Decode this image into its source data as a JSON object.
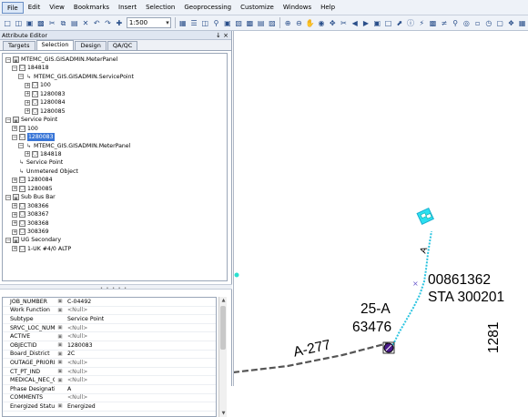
{
  "menu": [
    "File",
    "Edit",
    "View",
    "Bookmarks",
    "Insert",
    "Selection",
    "Geoprocessing",
    "Customize",
    "Windows",
    "Help"
  ],
  "toolbar": {
    "scale": "1:500"
  },
  "editor": {
    "title": "Attribute Editor",
    "title_buttons": "↓ ×",
    "tabs": [
      "Targets",
      "Selection",
      "Design",
      "QA/QC"
    ],
    "tree": [
      {
        "t": "MTEMC_GIS.GISADMIN.MeterPanel",
        "ex": "−",
        "ic": "lyr"
      },
      {
        "t": "184818",
        "ex": "−",
        "ic": "row"
      },
      {
        "t": "MTEMC_GIS.GISADMIN.ServicePoint",
        "ex": "−",
        "ic": "rel"
      },
      {
        "t": "100",
        "ex": "+",
        "ic": "row"
      },
      {
        "t": "1280083",
        "ex": "+",
        "ic": "row"
      },
      {
        "t": "1280084",
        "ex": "+",
        "ic": "row"
      },
      {
        "t": "1280085",
        "ex": "+",
        "ic": "row"
      },
      {
        "t": "Service Point",
        "ex": "−",
        "ic": "lyr"
      },
      {
        "t": "100",
        "ex": "+",
        "ic": "row"
      },
      {
        "t": "1280083",
        "ex": "−",
        "ic": "row",
        "selected": true
      },
      {
        "t": "MTEMC_GIS.GISADMIN.MeterPanel",
        "ex": "−",
        "ic": "rel"
      },
      {
        "t": "184818",
        "ex": "+",
        "ic": "row"
      },
      {
        "t": "Service Point",
        "ex": "",
        "ic": "rel"
      },
      {
        "t": "Unmetered Object",
        "ex": "",
        "ic": "rel"
      },
      {
        "t": "1280084",
        "ex": "+",
        "ic": "row"
      },
      {
        "t": "1280085",
        "ex": "+",
        "ic": "row"
      },
      {
        "t": "Sub Bus Bar",
        "ex": "−",
        "ic": "lyr"
      },
      {
        "t": "308366",
        "ex": "+",
        "ic": "row"
      },
      {
        "t": "308367",
        "ex": "+",
        "ic": "row"
      },
      {
        "t": "308368",
        "ex": "+",
        "ic": "row"
      },
      {
        "t": "308369",
        "ex": "+",
        "ic": "row"
      },
      {
        "t": "UG Secondary",
        "ex": "−",
        "ic": "lyr"
      },
      {
        "t": "1-UK #4/0 ALTP",
        "ex": "+",
        "ic": "row"
      }
    ],
    "attributes": [
      {
        "n": "JOB_NUMBER",
        "v": "C-04492",
        "lock": true
      },
      {
        "n": "Work Function",
        "v": "<Null>",
        "lock": true
      },
      {
        "n": "Subtype",
        "v": "Service Point",
        "lock": false
      },
      {
        "n": "SRVC_LOC_NUM",
        "v": "<Null>",
        "lock": true
      },
      {
        "n": "ACTIVE",
        "v": "<Null>",
        "lock": true
      },
      {
        "n": "OBJECTID",
        "v": "1280083",
        "lock": true
      },
      {
        "n": "Board_District",
        "v": "2C",
        "lock": true
      },
      {
        "n": "OUTAGE_PRIORITY",
        "v": "<Null>",
        "lock": true
      },
      {
        "n": "CT_PT_IND",
        "v": "<Null>",
        "lock": true
      },
      {
        "n": "MEDICAL_NEC_CD",
        "v": "<Null>",
        "lock": true
      },
      {
        "n": "Phase Designation",
        "v": "A",
        "lock": false
      },
      {
        "n": "COMMENTS",
        "v": "<Null>",
        "lock": false
      },
      {
        "n": "Energized Status",
        "v": "Energized",
        "lock": true
      },
      {
        "n": "",
        "v": "",
        "lock": false
      }
    ]
  },
  "map": {
    "label_meter": "00861362",
    "label_sta": "STA 300201",
    "label_pole": "25-A",
    "label_pole2": "63476",
    "label_line": "A-277",
    "label_phase": "A",
    "label_side": "1281",
    "colors": {
      "service_line": "#2bc4e0",
      "primary_line": "#555555",
      "device": "#4a1a8a"
    }
  }
}
